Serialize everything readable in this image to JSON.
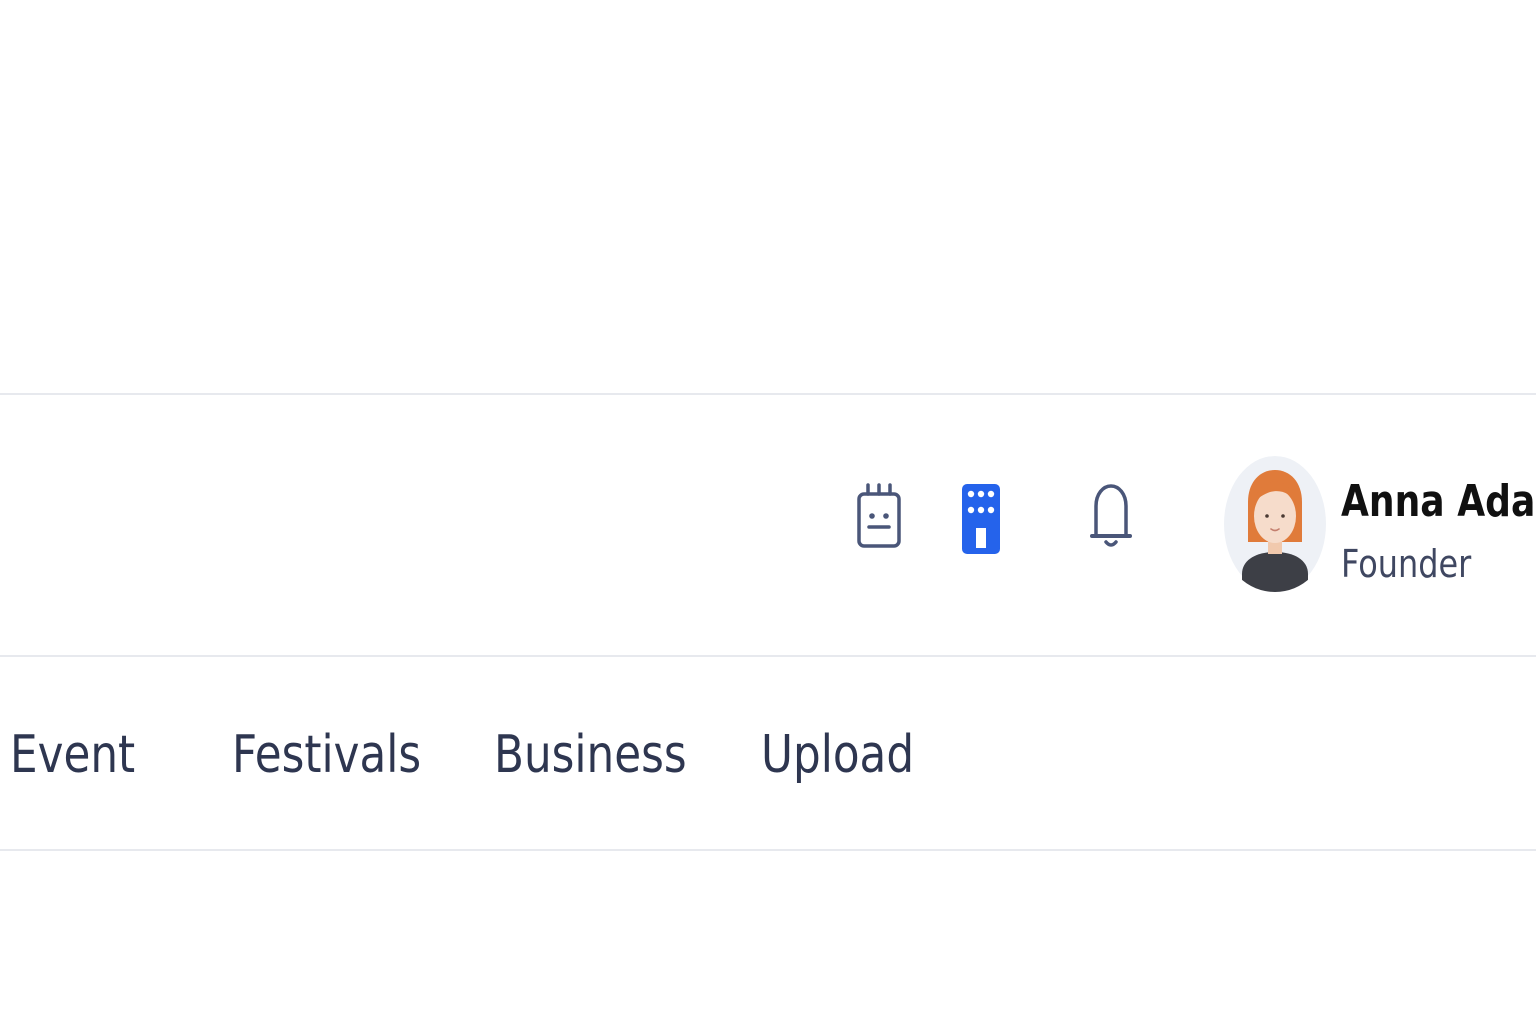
{
  "header": {
    "icons": [
      {
        "name": "calendar-icon",
        "color": "#4a5679"
      },
      {
        "name": "building-icon",
        "color": "#2563eb"
      },
      {
        "name": "bell-icon",
        "color": "#4a5679"
      }
    ],
    "user": {
      "name": "Anna Adam",
      "role": "Founder",
      "avatar": "avatar-woman-red-hair"
    }
  },
  "nav": {
    "tabs": [
      {
        "label": "Event"
      },
      {
        "label": "Festivals"
      },
      {
        "label": "Business"
      },
      {
        "label": "Upload"
      }
    ]
  },
  "colors": {
    "accent": "#2563eb",
    "text_primary": "#101010",
    "text_secondary": "#3f4761",
    "tab_text": "#2e3650",
    "divider": "#e7e9ee",
    "background": "#ffffff"
  }
}
